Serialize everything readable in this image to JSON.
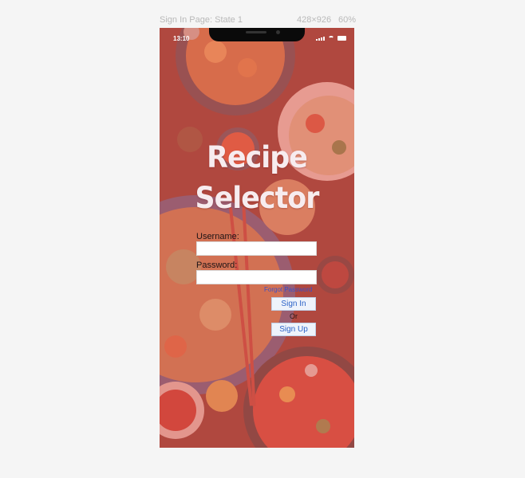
{
  "artboard": {
    "name": "Sign In Page: State 1",
    "size": "428×926",
    "zoom": "60%"
  },
  "status_bar": {
    "time": "13:10"
  },
  "app": {
    "title_line1": "Recipe",
    "title_line2": "Selector"
  },
  "form": {
    "username_label": "Username:",
    "username_value": "",
    "password_label": "Password:",
    "password_value": "",
    "forgot_password": "Forgot Password",
    "sign_in": "Sign In",
    "or": "Or",
    "sign_up": "Sign Up"
  },
  "colors": {
    "overlay": "#e8605a",
    "link": "#3b50c9",
    "button_text": "#2b62c7"
  },
  "icons": [
    "signal-icon",
    "wifi-icon",
    "battery-icon"
  ]
}
